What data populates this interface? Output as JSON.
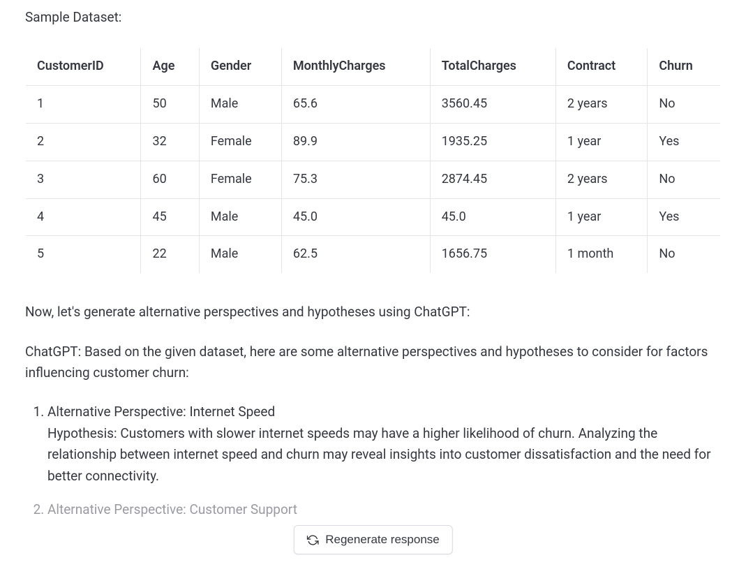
{
  "heading": "Sample Dataset:",
  "table": {
    "headers": [
      "CustomerID",
      "Age",
      "Gender",
      "MonthlyCharges",
      "TotalCharges",
      "Contract",
      "Churn"
    ],
    "rows": [
      [
        "1",
        "50",
        "Male",
        "65.6",
        "3560.45",
        "2 years",
        "No"
      ],
      [
        "2",
        "32",
        "Female",
        "89.9",
        "1935.25",
        "1 year",
        "Yes"
      ],
      [
        "3",
        "60",
        "Female",
        "75.3",
        "2874.45",
        "2 years",
        "No"
      ],
      [
        "4",
        "45",
        "Male",
        "45.0",
        "45.0",
        "1 year",
        "Yes"
      ],
      [
        "5",
        "22",
        "Male",
        "62.5",
        "1656.75",
        "1 month",
        "No"
      ]
    ]
  },
  "para1": "Now, let's generate alternative perspectives and hypotheses using ChatGPT:",
  "para2": "ChatGPT: Based on the given dataset, here are some alternative perspectives and hypotheses to consider for factors influencing customer churn:",
  "list": {
    "items": [
      {
        "title": "Alternative Perspective: Internet Speed",
        "hypothesis": "Hypothesis: Customers with slower internet speeds may have a higher likelihood of churn. Analyzing the relationship between internet speed and churn may reveal insights into customer dissatisfaction and the need for better connectivity."
      },
      {
        "title": "Alternative Perspective: Customer Support",
        "hypothesis": ""
      }
    ]
  },
  "regenerate_label": "Regenerate response"
}
